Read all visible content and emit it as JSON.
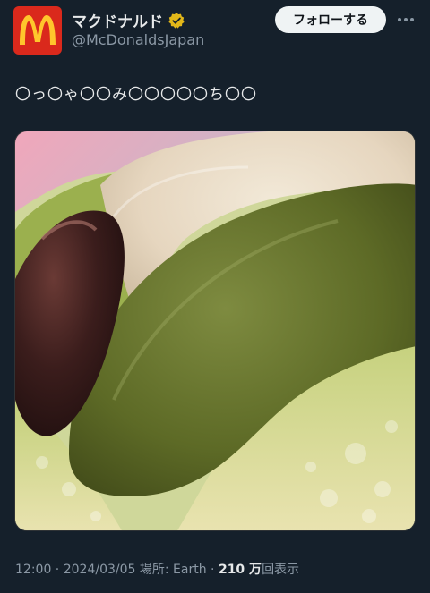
{
  "account": {
    "display_name": "マクドナルド",
    "handle": "@McDonaldsJapan",
    "avatar_icon": "mcdonalds-logo-icon",
    "verified_icon": "gold-verified-badge-icon",
    "brand_color": "#da291c"
  },
  "actions": {
    "follow_label": "フォローする",
    "more_icon": "more-options-icon"
  },
  "tweet": {
    "text": "〇っ〇ゃ〇〇み〇〇〇〇〇ち〇〇",
    "media_icon": "photo-matcha-pie-closeup"
  },
  "meta": {
    "time": "12:00",
    "sep1": " · ",
    "date": "2024/03/05",
    "sep2": " ",
    "location": "場所: Earth",
    "sep3": " · ",
    "views_count": "210 万",
    "views_label": "回表示"
  }
}
